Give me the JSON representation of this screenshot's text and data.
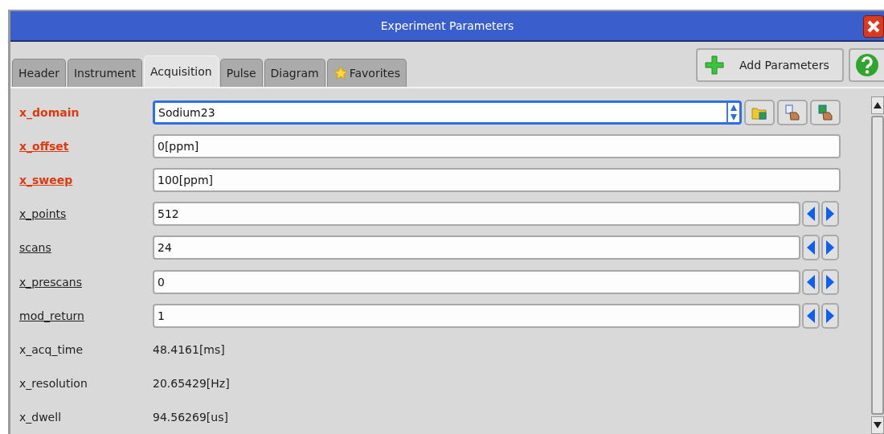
{
  "window": {
    "title": "Experiment Parameters"
  },
  "tabs": [
    {
      "label": "Header",
      "selected": false,
      "kind": "plain"
    },
    {
      "label": "Instrument",
      "selected": false,
      "kind": "plain"
    },
    {
      "label": "Acquisition",
      "selected": true,
      "kind": "plain"
    },
    {
      "label": "Pulse",
      "selected": false,
      "kind": "plain"
    },
    {
      "label": "Diagram",
      "selected": false,
      "kind": "plain"
    },
    {
      "label": "Favorites",
      "selected": false,
      "kind": "star"
    }
  ],
  "toolbar": {
    "add_button": "Add Parameters"
  },
  "parameters": [
    {
      "label": "x_domain",
      "kind": "select",
      "value": "Sodium23",
      "required": true,
      "underlined": false,
      "focused": true
    },
    {
      "label": "x_offset",
      "kind": "text",
      "value": "0[ppm]",
      "required": true,
      "underlined": true,
      "focused": false
    },
    {
      "label": "x_sweep",
      "kind": "text",
      "value": "100[ppm]",
      "required": true,
      "underlined": true,
      "focused": false
    },
    {
      "label": "x_points",
      "kind": "stepper",
      "value": "512",
      "required": false,
      "underlined": true,
      "focused": false
    },
    {
      "label": "scans",
      "kind": "stepper",
      "value": "24",
      "required": false,
      "underlined": true,
      "focused": false
    },
    {
      "label": "x_prescans",
      "kind": "stepper",
      "value": "0",
      "required": false,
      "underlined": true,
      "focused": false
    },
    {
      "label": "mod_return",
      "kind": "stepper",
      "value": "1",
      "required": false,
      "underlined": true,
      "focused": false
    },
    {
      "label": "x_acq_time",
      "kind": "readonly",
      "value": "48.4161[ms]",
      "required": false,
      "underlined": false
    },
    {
      "label": "x_resolution",
      "kind": "readonly",
      "value": "20.65429[Hz]",
      "required": false,
      "underlined": false
    },
    {
      "label": "x_dwell",
      "kind": "readonly",
      "value": "94.56269[us]",
      "required": false,
      "underlined": false
    }
  ]
}
